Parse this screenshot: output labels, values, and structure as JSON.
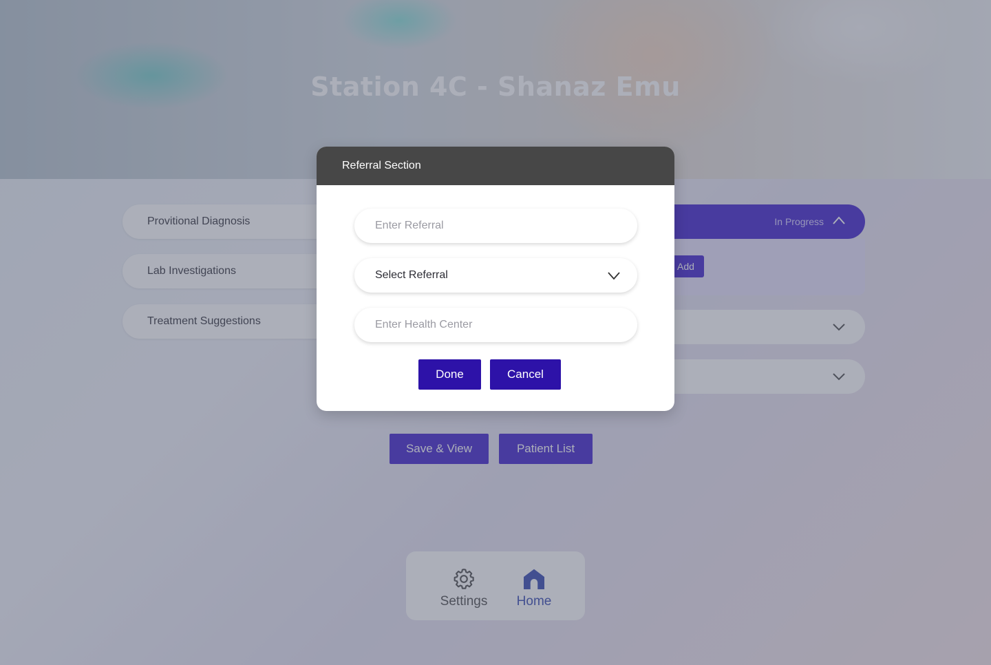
{
  "page": {
    "title": "Station 4C - Shanaz Emu"
  },
  "accordion": {
    "left_items": [
      {
        "label": "Provitional Diagnosis"
      },
      {
        "label": "Lab Investigations"
      },
      {
        "label": "Treatment Suggestions"
      }
    ],
    "right_open_section": {
      "status": "In Progress",
      "add_label": "Add"
    }
  },
  "actions": {
    "save_view_label": "Save & View",
    "patient_list_label": "Patient List"
  },
  "bottom_nav": {
    "settings_label": "Settings",
    "home_label": "Home",
    "active": "Home"
  },
  "modal": {
    "title": "Referral Section",
    "referral_placeholder": "Enter Referral",
    "select_referral_value": "Select Referral",
    "health_center_placeholder": "Enter Health Center",
    "done_label": "Done",
    "cancel_label": "Cancel"
  },
  "colors": {
    "accent": "#4a2ccf",
    "modal_button": "#2d12a8",
    "modal_header": "#474747",
    "nav_active": "#3f51b5"
  }
}
